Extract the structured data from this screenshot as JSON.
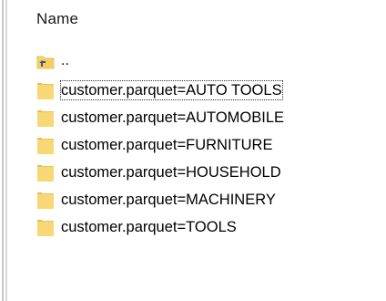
{
  "header": {
    "name_column": "Name"
  },
  "parent": {
    "label": ".."
  },
  "items": [
    {
      "label": "customer.parquet=AUTO TOOLS",
      "focused": true
    },
    {
      "label": "customer.parquet=AUTOMOBILE",
      "focused": false
    },
    {
      "label": "customer.parquet=FURNITURE",
      "focused": false
    },
    {
      "label": "customer.parquet=HOUSEHOLD",
      "focused": false
    },
    {
      "label": "customer.parquet=MACHINERY",
      "focused": false
    },
    {
      "label": "customer.parquet=TOOLS",
      "focused": false
    }
  ],
  "colors": {
    "folder_fill": "#f8d775",
    "folder_back": "#e8b94a",
    "up_arrow": "#2a5a8c"
  },
  "icons": {
    "parent": "parent-folder-up-icon",
    "folder": "folder-icon"
  }
}
